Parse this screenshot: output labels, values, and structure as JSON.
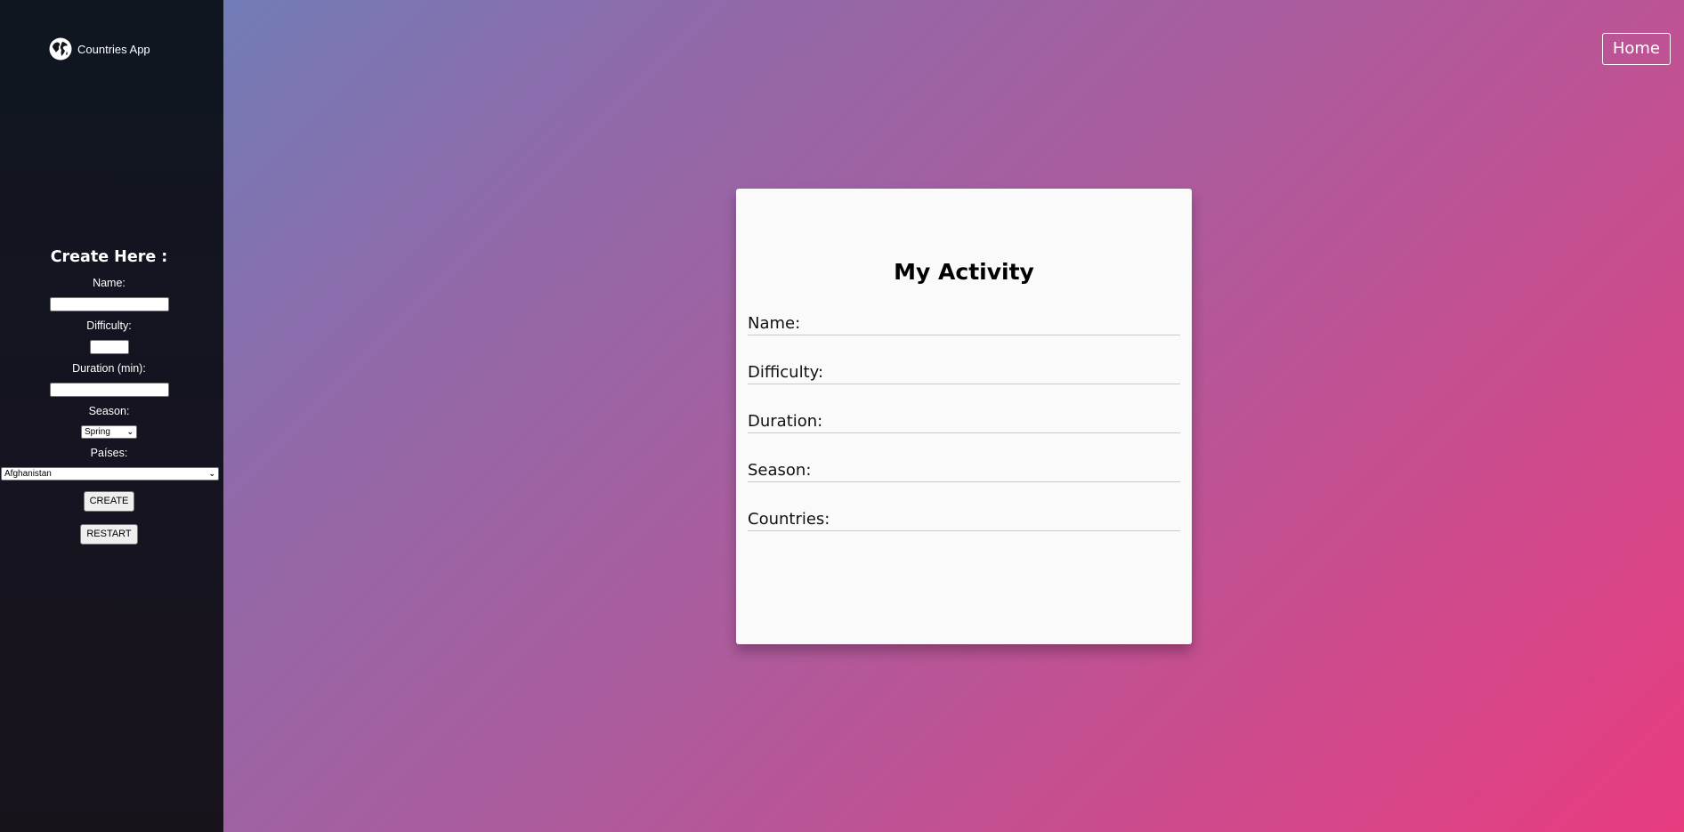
{
  "app": {
    "name": "Countries App",
    "logo_icon": "globe-icon"
  },
  "sidebar": {
    "form_title": "Create Here :",
    "name_label": "Name:",
    "name_value": "",
    "difficulty_label": "Difficulty:",
    "difficulty_value": "",
    "duration_label": "Duration (min):",
    "duration_value": "",
    "season_label": "Season:",
    "season_selected": "Spring",
    "countries_label": "Países:",
    "countries_selected": "Afghanistan",
    "create_button": "CREATE",
    "restart_button": "RESTART"
  },
  "header": {
    "home_button": "Home"
  },
  "card": {
    "title": "My Activity",
    "name_label": "Name:",
    "difficulty_label": "Difficulty:",
    "duration_label": "Duration:",
    "season_label": "Season:",
    "countries_label": "Countries:"
  },
  "colors": {
    "sidebar_bg": "#12161f",
    "gradient_start": "#6485bc",
    "gradient_end": "#e83c7f",
    "card_bg": "#fafafa"
  }
}
